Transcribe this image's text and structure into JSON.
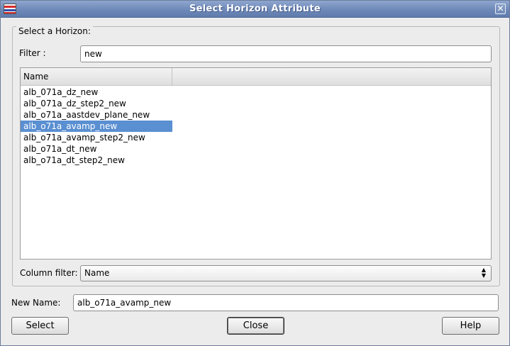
{
  "window": {
    "title": "Select Horizon Attribute",
    "close_glyph": "✕"
  },
  "horizon_group": {
    "title": "Select a Horizon:",
    "filter_label": "Filter :",
    "filter_value": "new",
    "table": {
      "column_header": "Name",
      "rows": [
        "alb_071a_dz_new",
        "alb_071a_dz_step2_new",
        "alb_o71a_aastdev_plane_new",
        "alb_o71a_avamp_new",
        "alb_o71a_avamp_step2_new",
        "alb_o71a_dt_new",
        "alb_o71a_dt_step2_new"
      ],
      "selected_index": 3
    },
    "column_filter_label": "Column filter:",
    "column_filter_value": "Name"
  },
  "new_name": {
    "label": "New Name:",
    "value": "alb_o71a_avamp_new"
  },
  "buttons": {
    "select": "Select",
    "close": "Close",
    "help": "Help"
  },
  "colors": {
    "title_bar": "#7690bd",
    "selection": "#5a8fd1"
  },
  "icons": {
    "app": "app-flag-icon",
    "close": "close-icon",
    "combo": "up-down-arrows-icon"
  }
}
